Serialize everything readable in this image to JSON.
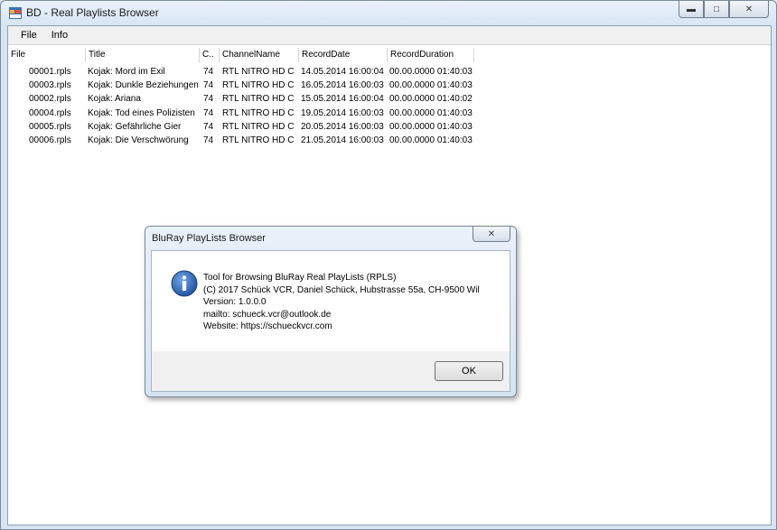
{
  "window": {
    "title": "BD - Real Playlists Browser"
  },
  "menu": [
    "File",
    "Info"
  ],
  "columns": [
    "File",
    "Title",
    "C..",
    "ChannelName",
    "RecordDate",
    "RecordDuration"
  ],
  "rows": [
    [
      "00001.rpls",
      "Kojak: Mord im Exil",
      "74",
      "RTL NITRO HD C",
      "14.05.2014 16:00:04",
      "00.00.0000 01:40:03"
    ],
    [
      "00003.rpls",
      "Kojak: Dunkle Beziehungen",
      "74",
      "RTL NITRO HD C",
      "16.05.2014 16:00:03",
      "00.00.0000 01:40:03"
    ],
    [
      "00002.rpls",
      "Kojak: Ariana",
      "74",
      "RTL NITRO HD C",
      "15.05.2014 16:00:04",
      "00.00.0000 01:40:02"
    ],
    [
      "00004.rpls",
      "Kojak: Tod eines Polizisten",
      "74",
      "RTL NITRO HD C",
      "19.05.2014 16:00:03",
      "00.00.0000 01:40:03"
    ],
    [
      "00005.rpls",
      "Kojak: Gefährliche Gier",
      "74",
      "RTL NITRO HD C",
      "20.05.2014 16:00:03",
      "00.00.0000 01:40:03"
    ],
    [
      "00006.rpls",
      "Kojak: Die Verschwörung",
      "74",
      "RTL NITRO HD C",
      "21.05.2014 16:00:03",
      "00.00.0000 01:40:03"
    ]
  ],
  "dialog": {
    "title": "BluRay PlayLists Browser",
    "lines": [
      "Tool for Browsing BluRay Real PlayLists (RPLS)",
      "(C) 2017 Schück VCR, Daniel Schück, Hubstrasse 55a, CH-9500 Wil",
      "Version: 1.0.0.0",
      "mailto:  schueck.vcr@outlook.de",
      "Website: https://schueckvcr.com"
    ],
    "ok_label": "OK"
  }
}
